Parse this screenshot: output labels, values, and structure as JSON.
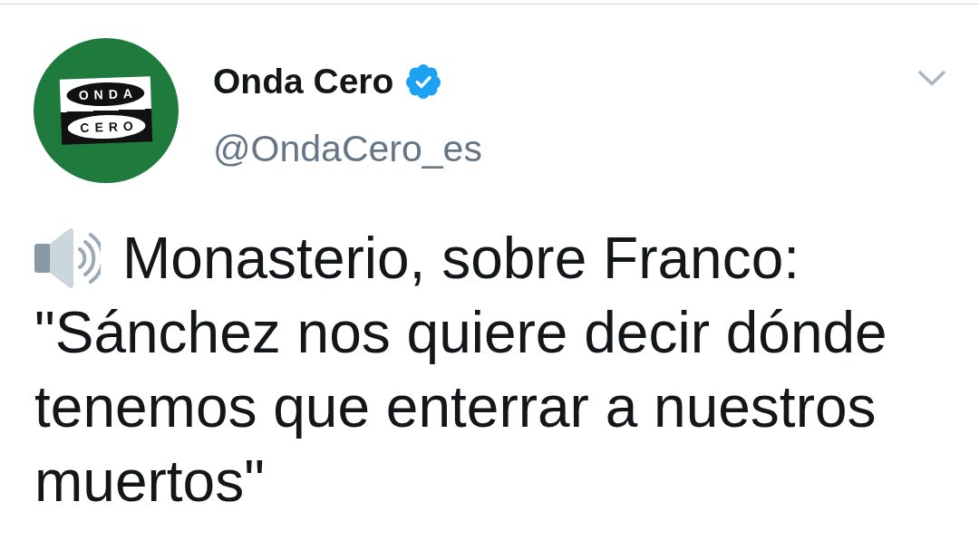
{
  "tweet": {
    "author": {
      "avatar_logo": [
        "ONDA",
        "CERO"
      ],
      "name": "Onda Cero",
      "verified": true,
      "handle": "@OndaCero_es"
    },
    "lead": "Monasterio, sobre Franco:",
    "quote": "\"Sánchez nos quiere decir dónde tenemos que enterrar a nuestros muertos\""
  }
}
